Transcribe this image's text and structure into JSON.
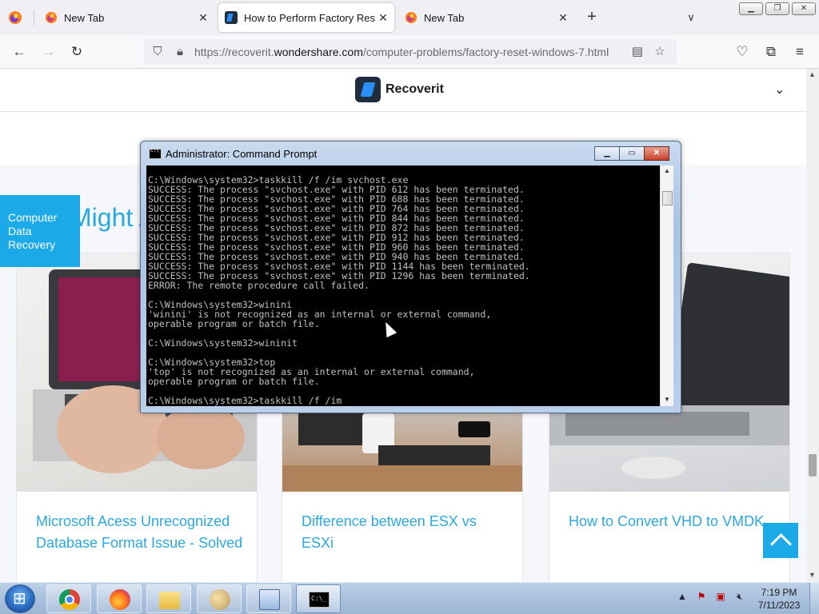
{
  "browser": {
    "tabs": [
      {
        "label": "New Tab",
        "active": false
      },
      {
        "label": "How to Perform Factory Reset on",
        "active": true
      },
      {
        "label": "New Tab",
        "active": false
      }
    ],
    "url_prefix": "https://recoverit.",
    "url_domain": "wondershare.com",
    "url_path": "/computer-problems/factory-reset-windows-7.html"
  },
  "page": {
    "logo_text": "Recoverit",
    "section_heading": "Might A",
    "side_tab_label": "Computer Data Recovery",
    "cards": [
      {
        "title": "Microsoft Acess Unrecognized Database Format Issue - Solved"
      },
      {
        "title": "Difference between ESX vs ESXi"
      },
      {
        "title": "How to Convert VHD to VMDK"
      }
    ]
  },
  "cmd": {
    "title": "Administrator:  Command Prompt",
    "lines": [
      "C:\\Windows\\system32>taskkill /f /im svchost.exe",
      "SUCCESS: The process \"svchost.exe\" with PID 612 has been terminated.",
      "SUCCESS: The process \"svchost.exe\" with PID 688 has been terminated.",
      "SUCCESS: The process \"svchost.exe\" with PID 764 has been terminated.",
      "SUCCESS: The process \"svchost.exe\" with PID 844 has been terminated.",
      "SUCCESS: The process \"svchost.exe\" with PID 872 has been terminated.",
      "SUCCESS: The process \"svchost.exe\" with PID 912 has been terminated.",
      "SUCCESS: The process \"svchost.exe\" with PID 960 has been terminated.",
      "SUCCESS: The process \"svchost.exe\" with PID 940 has been terminated.",
      "SUCCESS: The process \"svchost.exe\" with PID 1144 has been terminated.",
      "SUCCESS: The process \"svchost.exe\" with PID 1296 has been terminated.",
      "ERROR: The remote procedure call failed.",
      "",
      "C:\\Windows\\system32>winini",
      "'winini' is not recognized as an internal or external command,",
      "operable program or batch file.",
      "",
      "C:\\Windows\\system32>wininit",
      "",
      "C:\\Windows\\system32>top",
      "'top' is not recognized as an internal or external command,",
      "operable program or batch file.",
      "",
      "C:\\Windows\\system32>taskkill /f /im"
    ]
  },
  "taskbar": {
    "clock_time": "7:19 PM",
    "clock_date": "7/11/2023"
  },
  "colors": {
    "accent": "#2aa8e0",
    "side_tab": "#1ba9e8",
    "cmd_text": "#c0c0c0"
  }
}
